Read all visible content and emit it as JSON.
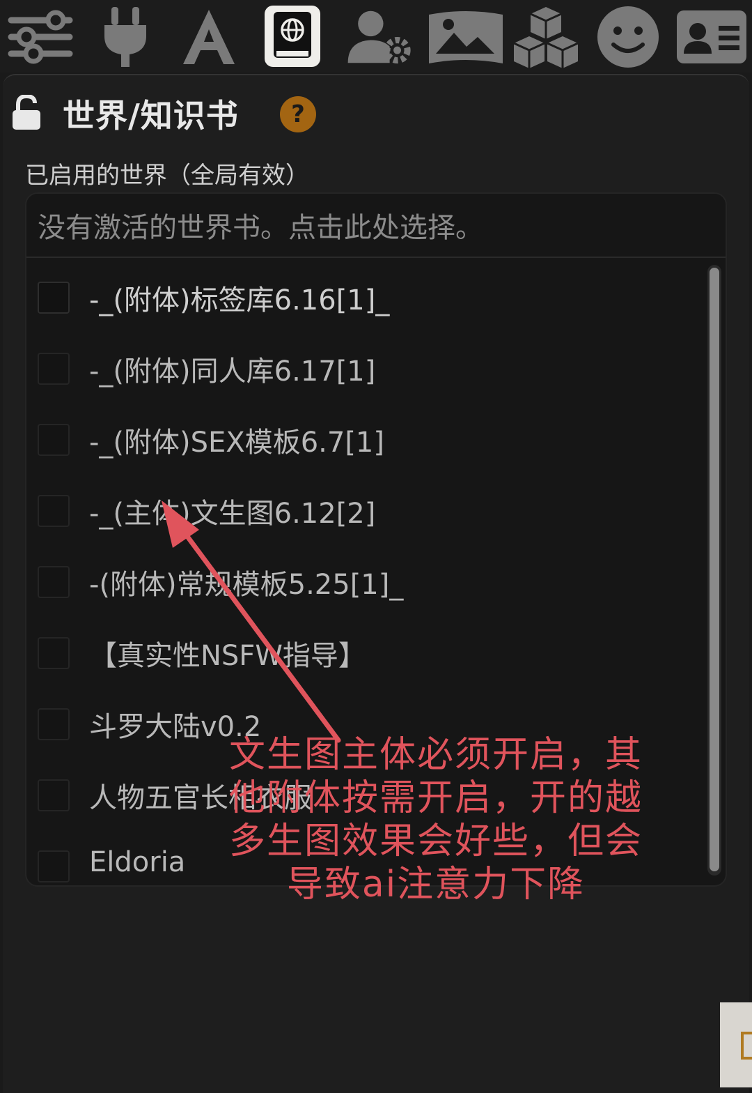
{
  "toolbar": {
    "icons": [
      "sliders-icon",
      "plug-icon",
      "font-icon",
      "world-book-icon",
      "user-settings-icon",
      "image-icon",
      "cubes-icon",
      "smile-icon",
      "id-card-icon"
    ],
    "active": "world-book-icon"
  },
  "panel": {
    "title": "世界/知识书",
    "help": "?",
    "subtitle": "已启用的世界（全局有效）"
  },
  "world_select": {
    "placeholder": "没有激活的世界书。点击此处选择。",
    "options": [
      {
        "label": "-_(附体)标签库6.16[1]_",
        "checked": false
      },
      {
        "label": "-_(附体)同人库6.17[1]",
        "checked": false
      },
      {
        "label": "-_(附体)SEX模板6.7[1]",
        "checked": false
      },
      {
        "label": "-_(主体)文生图6.12[2]",
        "checked": false
      },
      {
        "label": "-(附体)常规模板5.25[1]_",
        "checked": false
      },
      {
        "label": "【真实性NSFW指导】",
        "checked": false
      },
      {
        "label": "斗罗大陆v0.2",
        "checked": false
      },
      {
        "label": "人物五官长相衣服",
        "checked": false
      },
      {
        "label": "Eldoria",
        "checked": false
      }
    ]
  },
  "annotation": {
    "text": "文生图主体必须开启，其他附体按需开启，开的越多生图效果会好些，但会导致ai注意力下降",
    "color": "#e0545c"
  },
  "colors": {
    "background": "#1a1a1a",
    "help_badge": "#a36512",
    "active_tab": "#efeeea"
  }
}
